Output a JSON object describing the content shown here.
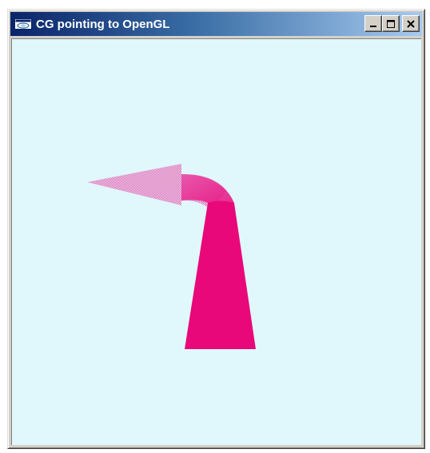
{
  "window": {
    "title": "CG pointing to OpenGL",
    "icon": "app-window-icon",
    "controls": {
      "minimize": "minimize-icon",
      "maximize": "maximize-icon",
      "close": "close-icon"
    }
  },
  "canvas": {
    "background_color": "#e0f8fc",
    "arrow_color": "#e8087a",
    "arrow_head_color": "#e84aa6",
    "arrow_direction": "up-then-left"
  }
}
